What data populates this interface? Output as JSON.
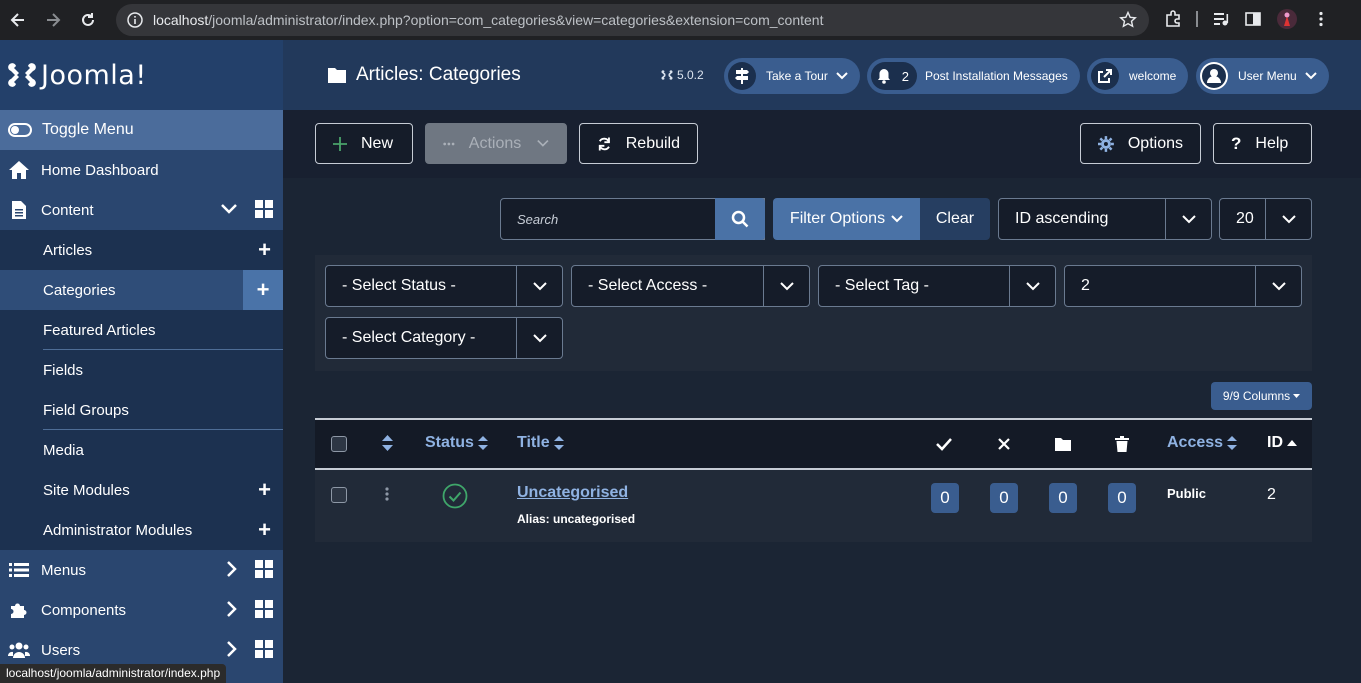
{
  "browser": {
    "url_host": "localhost",
    "url_path": "/joomla/administrator/index.php?option=com_categories&view=categories&extension=com_content",
    "status_url": "localhost/joomla/administrator/index.php"
  },
  "brand": {
    "name": "Joomla!"
  },
  "sidebar": {
    "toggle_label": "Toggle Menu",
    "home": "Home Dashboard",
    "content": "Content",
    "content_items": [
      {
        "label": "Articles"
      },
      {
        "label": "Categories"
      },
      {
        "label": "Featured Articles"
      },
      {
        "label": "Fields"
      },
      {
        "label": "Field Groups"
      },
      {
        "label": "Media"
      },
      {
        "label": "Site Modules"
      },
      {
        "label": "Administrator Modules"
      }
    ],
    "menus": "Menus",
    "components": "Components",
    "users": "Users"
  },
  "header": {
    "title": "Articles: Categories",
    "version": "5.0.2",
    "tour": "Take a Tour",
    "post_install_count": "2",
    "post_install": "Post Installation Messages",
    "welcome": "welcome",
    "user_menu": "User Menu"
  },
  "toolbar": {
    "new": "New",
    "actions": "Actions",
    "rebuild": "Rebuild",
    "options": "Options",
    "help": "Help"
  },
  "search": {
    "placeholder": "Search",
    "filter_options": "Filter Options",
    "clear": "Clear",
    "ordering": "ID ascending",
    "limit": "20"
  },
  "filters": {
    "status": "- Select Status -",
    "access": "- Select Access -",
    "tag": "- Select Tag -",
    "level": "2",
    "category": "- Select Category -"
  },
  "columns_btn": "9/9 Columns",
  "table": {
    "headers": {
      "status": "Status",
      "title": "Title",
      "access": "Access",
      "id": "ID"
    },
    "rows": [
      {
        "title": "Uncategorised",
        "alias": "Alias: uncategorised",
        "published": "0",
        "unpublished": "0",
        "archived": "0",
        "trashed": "0",
        "access": "Public",
        "id": "2"
      }
    ]
  }
}
